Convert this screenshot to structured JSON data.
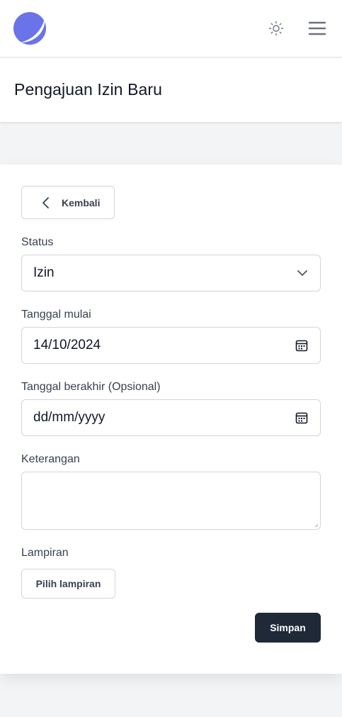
{
  "header": {
    "logo_icon": "logo-mark",
    "theme_icon": "sun-icon",
    "menu_icon": "hamburger-icon"
  },
  "page": {
    "title": "Pengajuan Izin Baru"
  },
  "form": {
    "back_label": "Kembali",
    "status": {
      "label": "Status",
      "value": "Izin"
    },
    "start_date": {
      "label": "Tanggal mulai",
      "value": "14/10/2024"
    },
    "end_date": {
      "label": "Tanggal berakhir (Opsional)",
      "placeholder": "dd/mm/yyyy"
    },
    "notes": {
      "label": "Keterangan",
      "value": ""
    },
    "attachment": {
      "label": "Lampiran",
      "button": "Pilih lampiran"
    },
    "submit_label": "Simpan"
  },
  "colors": {
    "logo": "#6b73e8",
    "primary_button": "#1f2937",
    "background": "#f3f4f6"
  }
}
